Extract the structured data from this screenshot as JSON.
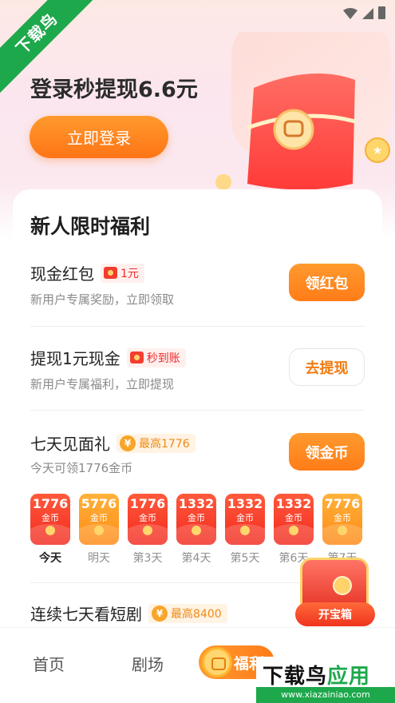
{
  "watermark": {
    "ribbon_text": "下载鸟"
  },
  "hero": {
    "title": "登录秒提现6.6元",
    "login_button": "立即登录"
  },
  "welfare": {
    "section_title": "新人限时福利",
    "tasks": [
      {
        "title": "现金红包",
        "tag": "1元",
        "subtitle": "新用户专属奖励，立即领取",
        "button": "领红包"
      },
      {
        "title": "提现1元现金",
        "tag": "秒到账",
        "subtitle": "新用户专属福利，立即提现",
        "button": "去提现"
      },
      {
        "title": "七天见面礼",
        "tag": "最高1776",
        "subtitle": "今天可领1776金币",
        "button": "领金币"
      },
      {
        "title": "连续七天看短剧",
        "tag": "最高8400"
      }
    ],
    "coin_symbol": "¥",
    "days": [
      {
        "amount": "1776",
        "unit": "金币",
        "label": "今天",
        "style": "red"
      },
      {
        "amount": "5776",
        "unit": "金币",
        "label": "明天",
        "style": "gold"
      },
      {
        "amount": "1776",
        "unit": "金币",
        "label": "第3天",
        "style": "red"
      },
      {
        "amount": "1332",
        "unit": "金币",
        "label": "第4天",
        "style": "red"
      },
      {
        "amount": "1332",
        "unit": "金币",
        "label": "第5天",
        "style": "red"
      },
      {
        "amount": "1332",
        "unit": "金币",
        "label": "第6天",
        "style": "red"
      },
      {
        "amount": "7776",
        "unit": "金币",
        "label": "第7天",
        "style": "gold"
      }
    ],
    "treasure_button": "开宝箱"
  },
  "tabbar": {
    "home": "首页",
    "theater": "剧场",
    "welfare": "福利"
  },
  "brand": {
    "name_black": "下载鸟",
    "name_green": "应用",
    "url": "www.xiazainiao.com"
  },
  "colors": {
    "accent": "#ff7c18",
    "red": "#f22a1f",
    "watermark_green": "#1da84b"
  }
}
